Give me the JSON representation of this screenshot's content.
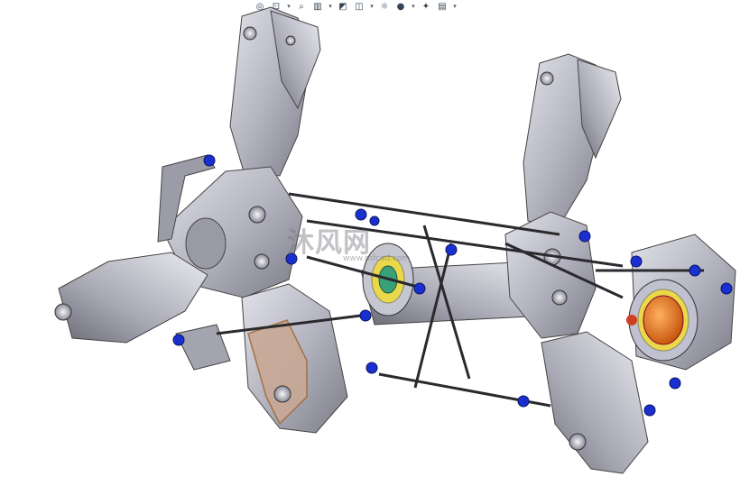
{
  "toolbar": {
    "buttons": [
      {
        "name": "view-orientation-icon",
        "glyph": "◎"
      },
      {
        "name": "zoom-to-fit-icon",
        "glyph": "⊡"
      },
      {
        "name": "zoom-area-icon",
        "glyph": "⌕"
      },
      {
        "name": "section-view-icon",
        "glyph": "▥"
      },
      {
        "name": "display-style-icon",
        "glyph": "◩"
      },
      {
        "name": "hide-show-icon",
        "glyph": "◫"
      },
      {
        "name": "edit-appearance-icon",
        "glyph": "☼"
      },
      {
        "name": "apply-scene-icon",
        "glyph": "●"
      },
      {
        "name": "render-tools-icon",
        "glyph": "✦"
      },
      {
        "name": "view-settings-icon",
        "glyph": "▤"
      }
    ]
  },
  "watermark": {
    "text": "沐风网",
    "subtext": "www.mfcad.com"
  },
  "colors": {
    "background": "#ffffff",
    "part_gray": "#b8b8c2",
    "part_dark": "#6e6e7a",
    "link_blue": "#1a2fd0",
    "accent_orange": "#e8721c",
    "accent_yellow": "#e8d84a",
    "rod_black": "#2a2a2e"
  }
}
